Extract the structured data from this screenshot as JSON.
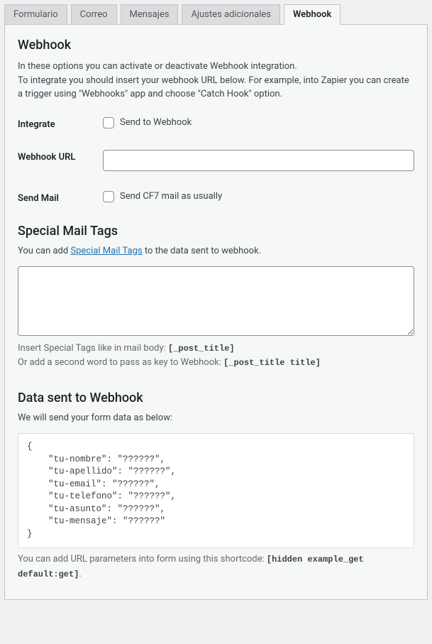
{
  "tabs": {
    "formulario": "Formulario",
    "correo": "Correo",
    "mensajes": "Mensajes",
    "ajustes": "Ajustes adicionales",
    "webhook": "Webhook"
  },
  "section_webhook": {
    "title": "Webhook",
    "desc_line1": "In these options you can activate or deactivate Webhook integration.",
    "desc_line2": "To integrate you should insert your webhook URL below. For example, into Zapier you can create a trigger using \"Webhooks\" app and choose \"Catch Hook\" option."
  },
  "fields": {
    "integrate_label": "Integrate",
    "integrate_cb": "Send to Webhook",
    "url_label": "Webhook URL",
    "url_value": "",
    "sendmail_label": "Send Mail",
    "sendmail_cb": "Send CF7 mail as usually"
  },
  "special_tags": {
    "title": "Special Mail Tags",
    "desc_pre": "You can add ",
    "desc_link": "Special Mail Tags",
    "desc_post": " to the data sent to webhook.",
    "textarea_value": "",
    "hint1_pre": "Insert Special Tags like in mail body: ",
    "hint1_code": "[_post_title]",
    "hint2_pre": "Or add a second word to pass as key to Webhook: ",
    "hint2_code": "[_post_title title]"
  },
  "data_sent": {
    "title": "Data sent to Webhook",
    "intro": "We will send your form data as below:",
    "json_preview": "{\n    \"tu-nombre\": \"??????\",\n    \"tu-apellido\": \"??????\",\n    \"tu-email\": \"??????\",\n    \"tu-telefono\": \"??????\",\n    \"tu-asunto\": \"??????\",\n    \"tu-mensaje\": \"??????\"\n}",
    "footer_pre": "You can add URL parameters into form using this shortcode: ",
    "footer_code": "[hidden example_get default:get]",
    "footer_post": "."
  }
}
